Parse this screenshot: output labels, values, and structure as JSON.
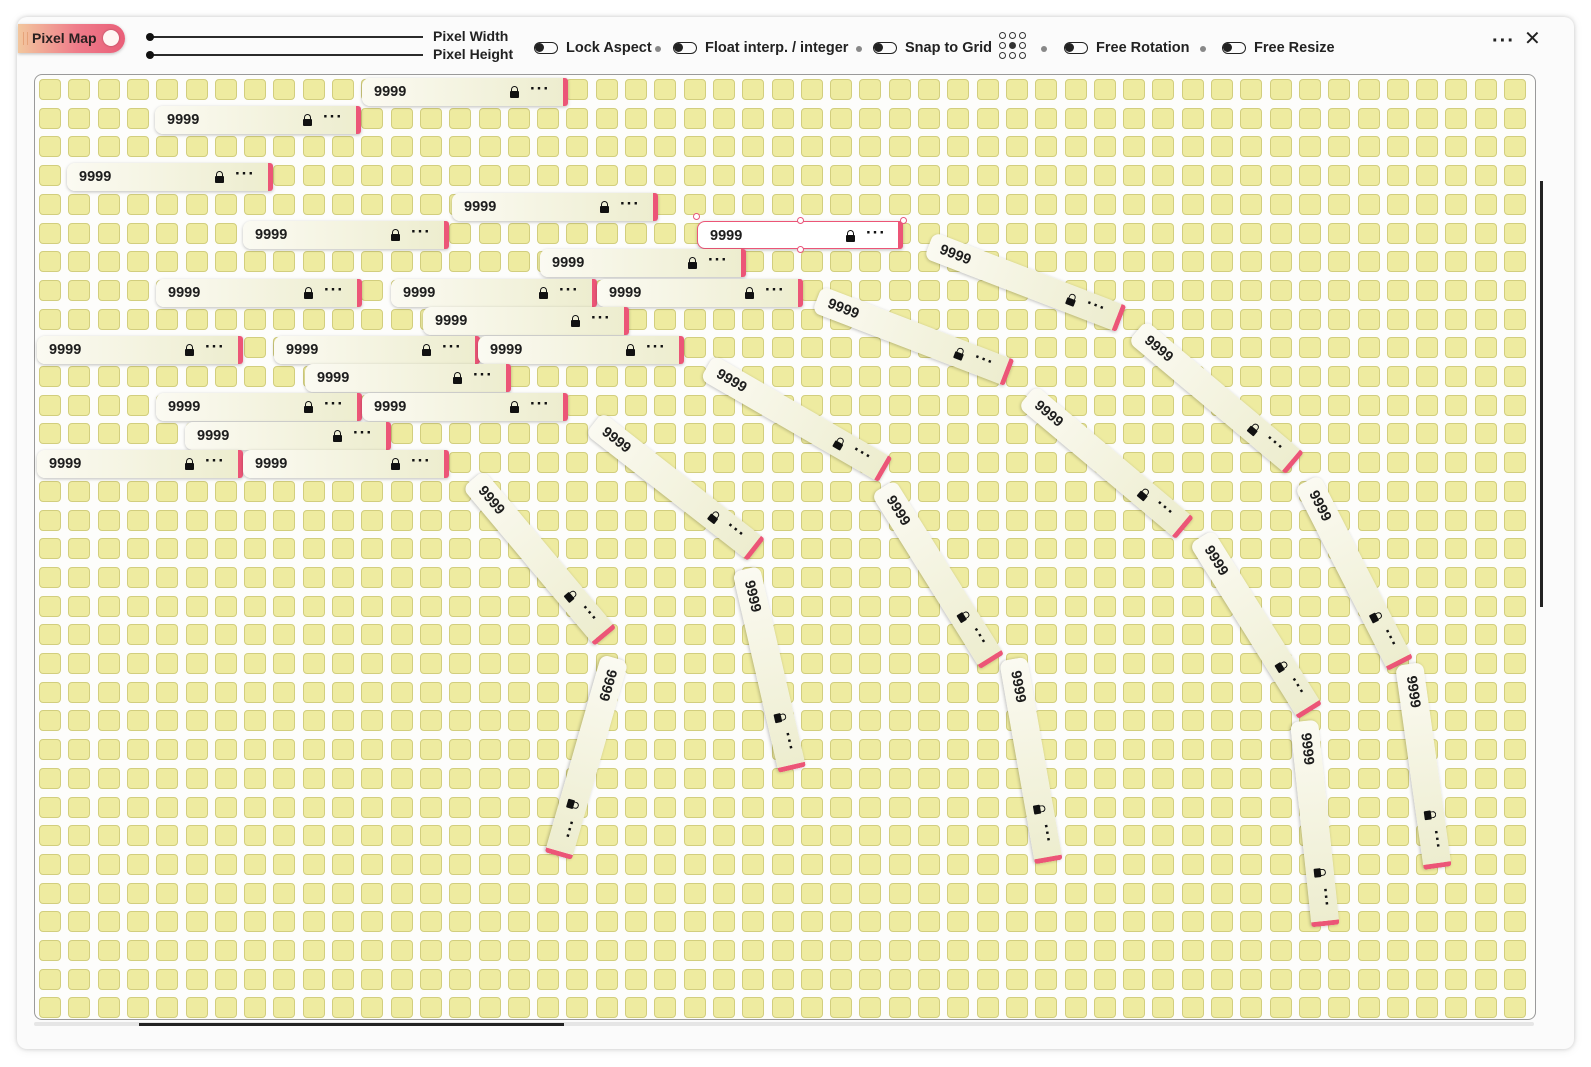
{
  "toolbar": {
    "title": "Pixel Map",
    "slider_width_label": "Pixel Width",
    "slider_height_label": "Pixel Height",
    "toggles": [
      {
        "label": "Lock Aspect",
        "on": false
      },
      {
        "label": "Float interp. / integer",
        "on": false
      },
      {
        "label": "Snap to Grid",
        "on": false
      },
      {
        "label": "Free Rotation",
        "on": false
      },
      {
        "label": "Free Resize",
        "on": false
      }
    ],
    "more_label": "···",
    "close_label": "✕"
  },
  "canvas": {
    "cell_color": "#eeeba0",
    "accent_color": "#ec5577",
    "tags_value": "9999",
    "tags": [
      {
        "value": "9999",
        "selected": false
      },
      {
        "value": "9999",
        "selected": false
      },
      {
        "value": "9999",
        "selected": false
      },
      {
        "value": "9999",
        "selected": false
      },
      {
        "value": "9999",
        "selected": false
      },
      {
        "value": "9999",
        "selected": true
      },
      {
        "value": "9999",
        "selected": false
      },
      {
        "value": "9999",
        "selected": false
      },
      {
        "value": "9999",
        "selected": false
      },
      {
        "value": "9999",
        "selected": false
      },
      {
        "value": "9999",
        "selected": false
      },
      {
        "value": "9999",
        "selected": false
      },
      {
        "value": "9999",
        "selected": false
      },
      {
        "value": "9999",
        "selected": false
      },
      {
        "value": "9999",
        "selected": false
      },
      {
        "value": "9999",
        "selected": false
      },
      {
        "value": "9999",
        "selected": false
      },
      {
        "value": "9999",
        "selected": false
      },
      {
        "value": "9999",
        "selected": false
      },
      {
        "value": "9999",
        "selected": false
      },
      {
        "value": "9999",
        "selected": false
      },
      {
        "value": "9999",
        "selected": false
      },
      {
        "value": "9999",
        "selected": false
      },
      {
        "value": "9999",
        "selected": false
      },
      {
        "value": "9999",
        "selected": false
      },
      {
        "value": "9999",
        "selected": false
      },
      {
        "value": "9999",
        "selected": false
      },
      {
        "value": "9999",
        "selected": false
      },
      {
        "value": "9999",
        "selected": false
      },
      {
        "value": "9999",
        "selected": false
      },
      {
        "value": "9999",
        "selected": false
      },
      {
        "value": "9999",
        "selected": false
      },
      {
        "value": "9999",
        "selected": false
      },
      {
        "value": "9999",
        "selected": false
      },
      {
        "value": "9999",
        "selected": false
      }
    ]
  }
}
